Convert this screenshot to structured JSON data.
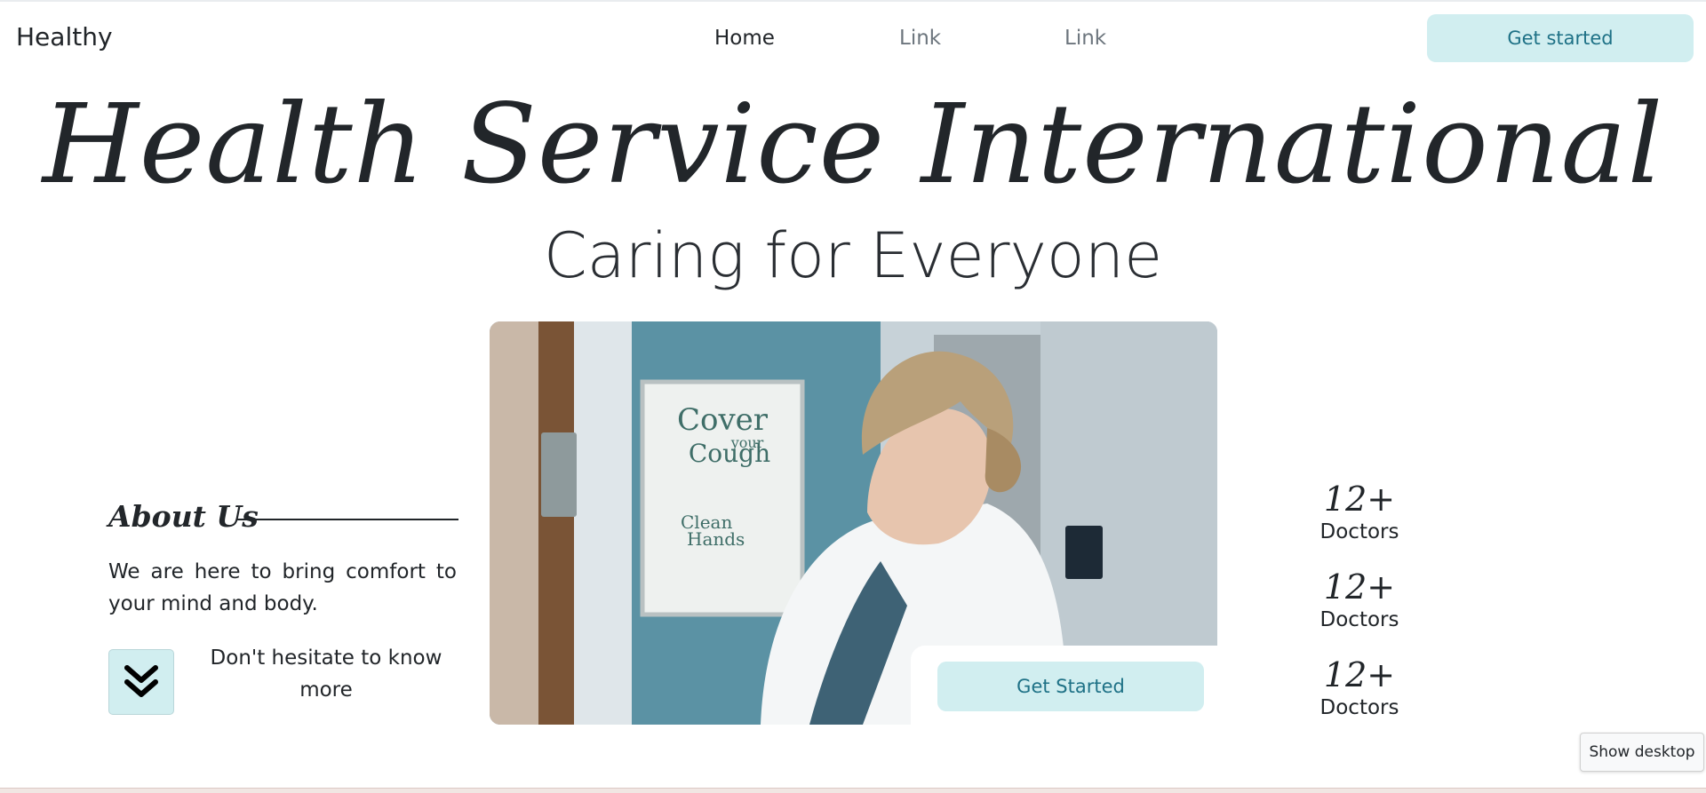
{
  "navbar": {
    "brand": "Healthy",
    "links": [
      "Home",
      "Link",
      "Link"
    ],
    "cta_label": "Get started"
  },
  "hero": {
    "title": "Health Service International",
    "subtitle": "Caring for Everyone",
    "photo_cta_label": "Get Started"
  },
  "about": {
    "title": "About Us",
    "text": "We are here to bring comfort to your mind and body.",
    "know_more": "Don't hesitate to know more",
    "expand_icon": "double-chevron-down-icon"
  },
  "stats": [
    {
      "value": "12+",
      "label": "Doctors"
    },
    {
      "value": "12+",
      "label": "Doctors"
    },
    {
      "value": "12+",
      "label": "Doctors"
    }
  ],
  "poster": {
    "line1": "Cover",
    "line2": "your",
    "line3": "Cough",
    "line4": "Clean",
    "line5": "Hands"
  },
  "overlay": {
    "show_desktop": "Show desktop"
  },
  "colors": {
    "accent_bg": "#d1eef0",
    "accent_text": "#1e7186",
    "text": "#212529",
    "muted": "#6c757d"
  }
}
